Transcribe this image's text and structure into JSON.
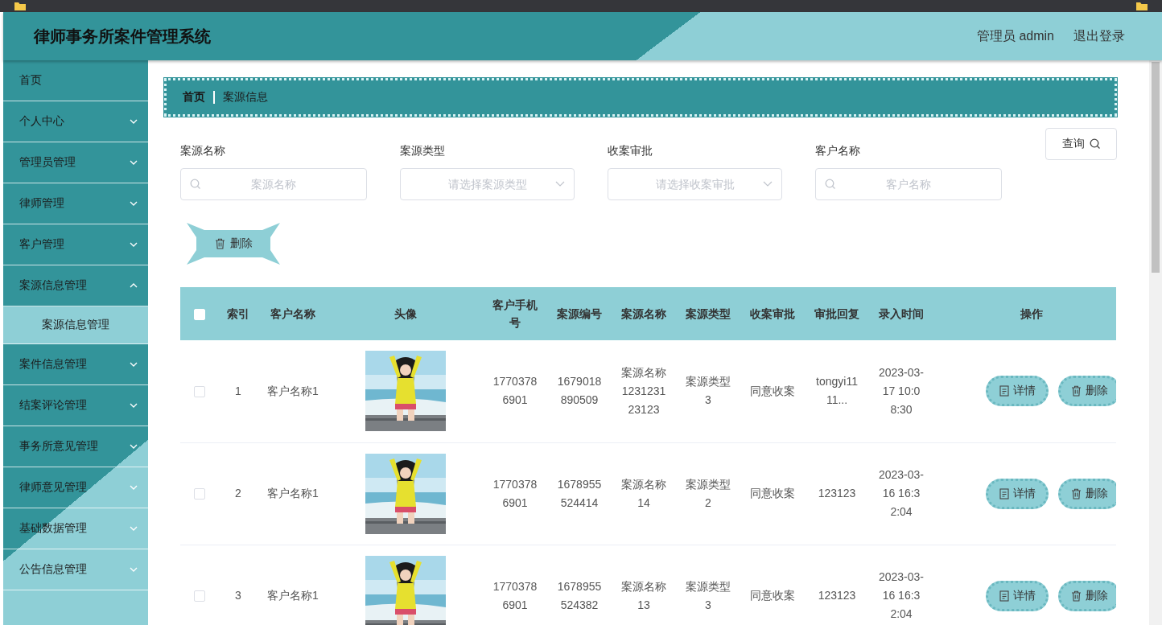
{
  "header": {
    "title": "律师事务所案件管理系统",
    "user": "管理员 admin",
    "logout": "退出登录"
  },
  "sidebar": {
    "items": [
      {
        "label": "首页"
      },
      {
        "label": "个人中心",
        "expanded": false
      },
      {
        "label": "管理员管理",
        "expanded": false
      },
      {
        "label": "律师管理",
        "expanded": false
      },
      {
        "label": "客户管理",
        "expanded": false
      },
      {
        "label": "案源信息管理",
        "expanded": true,
        "children": [
          {
            "label": "案源信息管理",
            "selected": true
          }
        ]
      },
      {
        "label": "案件信息管理",
        "expanded": false
      },
      {
        "label": "结案评论管理",
        "expanded": false
      },
      {
        "label": "事务所意见管理",
        "expanded": false
      },
      {
        "label": "律师意见管理",
        "expanded": false
      },
      {
        "label": "基础数据管理",
        "expanded": false
      },
      {
        "label": "公告信息管理",
        "expanded": false
      }
    ]
  },
  "breadcrumb": [
    "首页",
    "案源信息"
  ],
  "filters": [
    {
      "kind": "search",
      "label": "案源名称",
      "placeholder": "案源名称"
    },
    {
      "kind": "select",
      "label": "案源类型",
      "placeholder": "请选择案源类型"
    },
    {
      "kind": "select",
      "label": "收案审批",
      "placeholder": "请选择收案审批"
    },
    {
      "kind": "search",
      "label": "客户名称",
      "placeholder": "客户名称"
    }
  ],
  "query_button": "查询",
  "delete_button": "删除",
  "table": {
    "all_checked": false,
    "columns": [
      "索引",
      "客户名称",
      "头像",
      "客户手机号",
      "案源编号",
      "案源名称",
      "案源类型",
      "收案审批",
      "审批回复",
      "录入时间",
      "操作"
    ],
    "rows": [
      {
        "checked": false,
        "cells": [
          "1",
          "客户名称1",
          {
            "kind": "picture"
          },
          "17703786901",
          "1679018890509",
          "案源名称123123123123",
          "案源类型3",
          "同意收案",
          "tongyi1111...",
          "2023-03-17 10:08:30"
        ],
        "actions": [
          "详情",
          "删除"
        ]
      },
      {
        "checked": false,
        "cells": [
          "2",
          "客户名称1",
          {
            "kind": "picture"
          },
          "17703786901",
          "1678955524414",
          "案源名称14",
          "案源类型2",
          "同意收案",
          "123123",
          "2023-03-16 16:32:04"
        ],
        "actions": [
          "详情",
          "删除"
        ]
      },
      {
        "checked": false,
        "cells": [
          "3",
          "客户名称1",
          {
            "kind": "picture"
          },
          "17703786901",
          "1678955524382",
          "案源名称13",
          "案源类型3",
          "同意收案",
          "123123",
          "2023-03-16 16:32:04"
        ],
        "actions": [
          "详情",
          "删除"
        ]
      }
    ]
  }
}
